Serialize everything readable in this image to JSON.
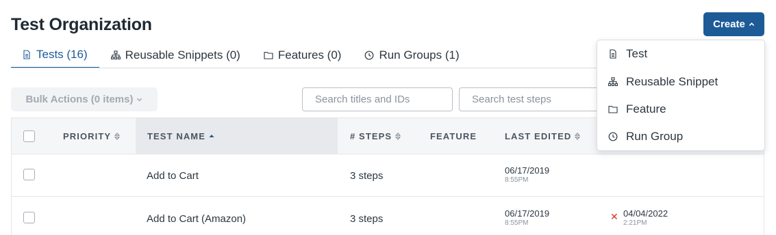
{
  "header": {
    "title": "Test Organization",
    "create_label": "Create"
  },
  "tabs": [
    {
      "label": "Tests (16)",
      "icon": "document-icon",
      "active": true
    },
    {
      "label": "Reusable Snippets (0)",
      "icon": "hierarchy-icon",
      "active": false
    },
    {
      "label": "Features (0)",
      "icon": "folder-icon",
      "active": false
    },
    {
      "label": "Run Groups (1)",
      "icon": "clock-icon",
      "active": false
    }
  ],
  "toolbar": {
    "bulk_actions_label": "Bulk Actions (0 items)",
    "search_titles_placeholder": "Search titles and IDs",
    "search_steps_placeholder": "Search test steps"
  },
  "table": {
    "columns": {
      "priority": "PRIORITY",
      "test_name": "TEST NAME",
      "steps": "# STEPS",
      "feature": "FEATURE",
      "last_edited": "LAST EDITED"
    },
    "rows": [
      {
        "name": "Add to Cart",
        "steps": "3 steps",
        "edited_date": "06/17/2019",
        "edited_time": "8:55PM",
        "status_date": "",
        "status_time": ""
      },
      {
        "name": "Add to Cart (Amazon)",
        "steps": "3 steps",
        "edited_date": "06/17/2019",
        "edited_time": "8:55PM",
        "status_date": "04/04/2022",
        "status_time": "2:21PM"
      }
    ]
  },
  "create_menu": {
    "items": [
      {
        "label": "Test",
        "icon": "document-icon"
      },
      {
        "label": "Reusable Snippet",
        "icon": "hierarchy-icon"
      },
      {
        "label": "Feature",
        "icon": "folder-icon"
      },
      {
        "label": "Run Group",
        "icon": "clock-icon"
      }
    ]
  },
  "colors": {
    "primary": "#1d5b97",
    "error": "#d3312a",
    "header_bg": "#f5f6f8"
  }
}
